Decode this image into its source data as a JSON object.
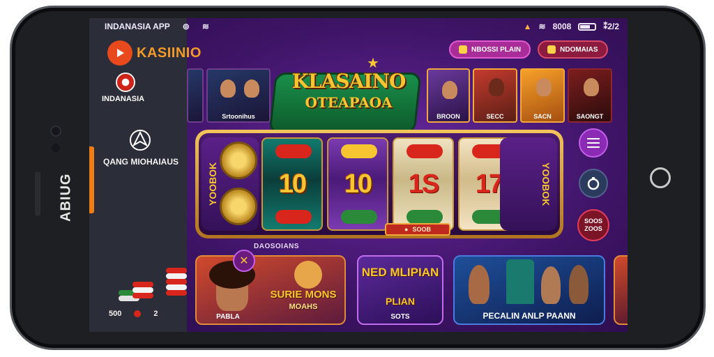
{
  "status_bar": {
    "carrier": "INDANASIA APP",
    "time": "8008",
    "network": "⁑2/2"
  },
  "sidebar": {
    "logo_text": "KASIINIO",
    "region_label": "INDANASIA",
    "nav_label": "QANG MIOHAIAUS",
    "footer_left": "500",
    "footer_right": "2"
  },
  "phone": {
    "brand_vertical": "ABIUG"
  },
  "top_pills": [
    {
      "label": "NBOSSI PLAIN"
    },
    {
      "label": "NDOMAIAS"
    }
  ],
  "hero": {
    "title": "KLASAINO",
    "subtitle": "OTEAPAOA"
  },
  "banners": [
    {
      "label": "Srtoonihus"
    },
    {
      "label": "BROON"
    },
    {
      "label": "SECC"
    },
    {
      "label": "SACN"
    },
    {
      "label": "SAONGT"
    }
  ],
  "slot": {
    "left_side_text": "YOOBOK",
    "right_side_text": "YOOBOK",
    "reels": [
      "10",
      "10",
      "1S",
      "17"
    ],
    "spin_label": "SOOB",
    "bonus_label": "SOOS ZOOS"
  },
  "games": {
    "section_label": "DAOSOIANS",
    "cards": [
      {
        "title": "",
        "caption": "PABLA"
      },
      {
        "title": "SURIE MONS",
        "subtitle": "MOAHS",
        "caption": ""
      },
      {
        "title": "NED MLIPIAN",
        "subtitle": "PLIAN",
        "caption": "SOTS"
      },
      {
        "title": "",
        "caption": "PECALIN ANLP PAANN"
      }
    ]
  },
  "colors": {
    "accent_orange": "#ee7d15",
    "gold": "#f7c531",
    "purple_bg": "#3e1466"
  }
}
